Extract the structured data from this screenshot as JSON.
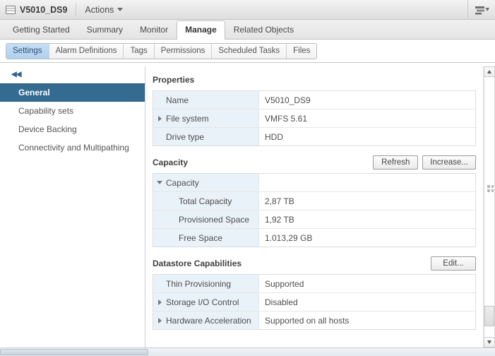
{
  "header": {
    "object_icon": "datastore-icon",
    "object_name": "V5010_DS9",
    "actions_label": "Actions",
    "actions_caret": "chevron-down-icon",
    "filter_icon": "filter-list-icon"
  },
  "primary_tabs": [
    {
      "label": "Getting Started",
      "active": false
    },
    {
      "label": "Summary",
      "active": false
    },
    {
      "label": "Monitor",
      "active": false
    },
    {
      "label": "Manage",
      "active": true
    },
    {
      "label": "Related Objects",
      "active": false
    }
  ],
  "secondary_tabs": [
    {
      "label": "Settings",
      "active": true
    },
    {
      "label": "Alarm Definitions",
      "active": false
    },
    {
      "label": "Tags",
      "active": false
    },
    {
      "label": "Permissions",
      "active": false
    },
    {
      "label": "Scheduled Tasks",
      "active": false
    },
    {
      "label": "Files",
      "active": false
    }
  ],
  "sidebar": {
    "collapse_icon": "double-chevron-left-icon",
    "collapse_glyph": "◀◀",
    "items": [
      {
        "label": "General",
        "selected": true
      },
      {
        "label": "Capability sets",
        "selected": false
      },
      {
        "label": "Device Backing",
        "selected": false
      },
      {
        "label": "Connectivity and Multipathing",
        "selected": false
      }
    ]
  },
  "sections": [
    {
      "title": "Properties",
      "buttons": [],
      "rows": [
        {
          "twisty": "none",
          "key": "Name",
          "value": "V5010_DS9",
          "indent": false
        },
        {
          "twisty": "collapsed",
          "key": "File system",
          "value": "VMFS 5.61",
          "indent": false
        },
        {
          "twisty": "none",
          "key": "Drive type",
          "value": "HDD",
          "indent": false
        }
      ]
    },
    {
      "title": "Capacity",
      "buttons": [
        {
          "label": "Refresh",
          "name": "refresh-button"
        },
        {
          "label": "Increase...",
          "name": "increase-button"
        }
      ],
      "rows": [
        {
          "twisty": "expanded",
          "key": "Capacity",
          "value": "",
          "indent": false
        },
        {
          "twisty": "none",
          "key": "Total Capacity",
          "value": "2,87 TB",
          "indent": true
        },
        {
          "twisty": "none",
          "key": "Provisioned Space",
          "value": "1,92 TB",
          "indent": true
        },
        {
          "twisty": "none",
          "key": "Free Space",
          "value": "1.013,29 GB",
          "indent": true
        }
      ]
    },
    {
      "title": "Datastore Capabilities",
      "buttons": [
        {
          "label": "Edit...",
          "name": "edit-button"
        }
      ],
      "rows": [
        {
          "twisty": "none",
          "key": "Thin Provisioning",
          "value": "Supported",
          "indent": false
        },
        {
          "twisty": "collapsed",
          "key": "Storage I/O Control",
          "value": "Disabled",
          "indent": false
        },
        {
          "twisty": "collapsed",
          "key": "Hardware Acceleration",
          "value": "Supported on all hosts",
          "indent": false
        }
      ]
    }
  ],
  "scrollbars": {
    "vertical": {
      "up_icon": "scroll-up-arrow-icon",
      "down_icon": "scroll-down-arrow-icon",
      "thumb_name": "vertical-scroll-thumb"
    },
    "horizontal": {
      "thumb_name": "horizontal-scroll-thumb"
    },
    "splitter": {
      "name": "panel-splitter-grip"
    }
  }
}
